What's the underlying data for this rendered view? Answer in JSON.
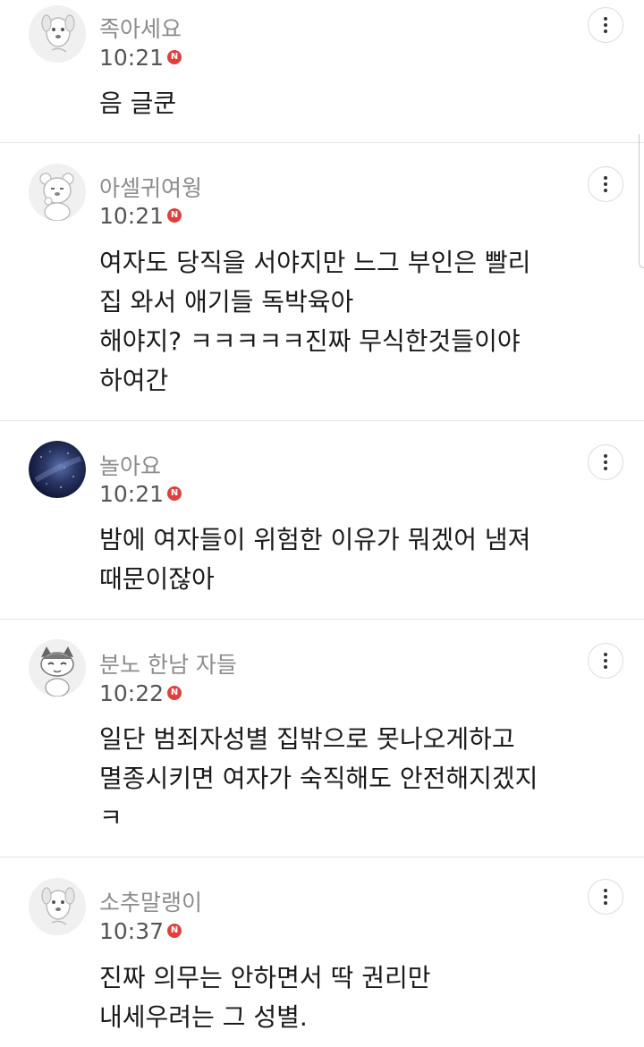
{
  "comments": [
    {
      "nickname": "족아세요",
      "time": "10:21",
      "badge": "N",
      "text": "음 글쿤",
      "avatar": "dog-character-avatar"
    },
    {
      "nickname": "아셀귀여웡",
      "time": "10:21",
      "badge": "N",
      "text": "여자도 당직을 서야지만 느그 부인은 빨리\n집 와서 애기들 독박육아\n해야지? ㅋㅋㅋㅋㅋ진짜 무식한것들이야\n하여간",
      "avatar": "bear-character-avatar"
    },
    {
      "nickname": "놀아요",
      "time": "10:21",
      "badge": "N",
      "text": "밤에 여자들이 위험한 이유가 뭐겠어 냄져\n때문이잖아",
      "avatar": "night-sky-avatar"
    },
    {
      "nickname": "분노 한남 자들",
      "time": "10:22",
      "badge": "N",
      "text": "일단 범죄자성별 집밖으로 못나오게하고\n멸종시키면 여자가 숙직해도 안전해지겠지\nㅋ",
      "avatar": "cat-character-avatar"
    },
    {
      "nickname": "소추말랭이",
      "time": "10:37",
      "badge": "N",
      "text": "진짜 의무는 안하면서 딱 권리만\n내세우려는 그 성별.",
      "avatar": "dog-character-avatar"
    }
  ],
  "colors": {
    "nickname": "#8c8c8c",
    "time": "#555555",
    "badge": "#e03f3f",
    "text": "#1a1a1a",
    "divider": "#e6e6e6"
  },
  "icons": {
    "more": "more-vertical-icon",
    "new": "new-badge-icon"
  }
}
